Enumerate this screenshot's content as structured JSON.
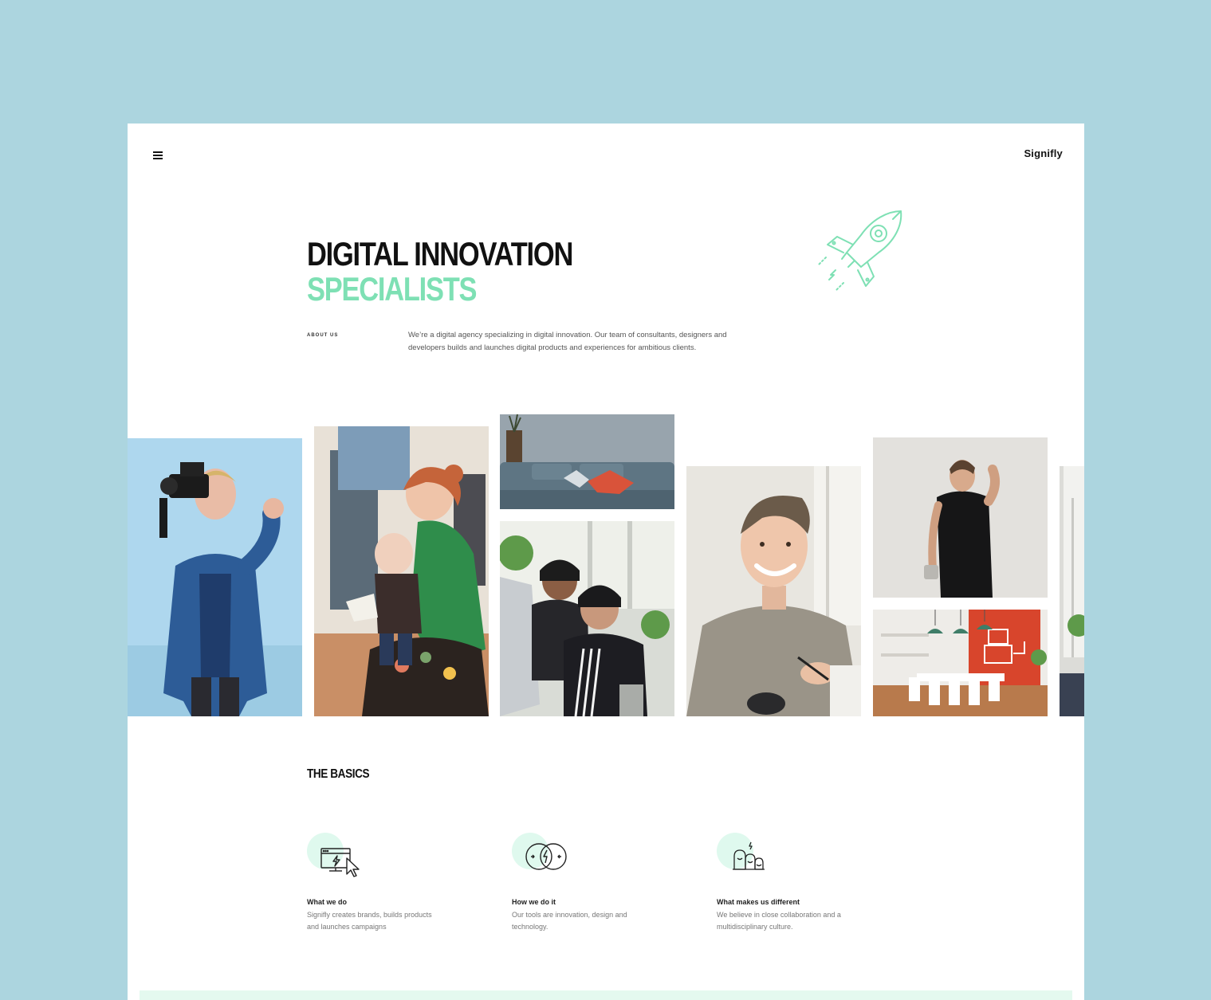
{
  "header": {
    "menu_icon": "hamburger-menu-icon",
    "logo": "Signifly"
  },
  "hero": {
    "title_line1": "DIGITAL INNOVATION",
    "title_line2": "SPECIALISTS",
    "illustration_icon": "rocket-icon",
    "about_label": "ABOUT US",
    "about_text": "We’re a digital agency specializing in digital innovation. Our team of consultants, designers and developers builds and launches digital products and experiences for ambitious clients."
  },
  "gallery": {
    "photos": [
      "videographer-photo",
      "woman-with-child-photo",
      "sofa-photo",
      "coworkers-photo",
      "smiling-man-photo",
      "man-with-mug-photo",
      "office-kitchen-photo",
      "window-photo"
    ]
  },
  "basics": {
    "title": "THE BASICS",
    "items": [
      {
        "icon": "computer-cursor-icon",
        "title": "What we do",
        "description": "Signifly creates brands, builds products and launches campaigns"
      },
      {
        "icon": "overlapping-circles-icon",
        "title": "How we do it",
        "description": "Our tools are innovation, design and technology."
      },
      {
        "icon": "team-faces-icon",
        "title": "What makes us different",
        "description": "We believe in close collaboration and a multidisciplinary culture."
      }
    ]
  },
  "colors": {
    "background": "#acd5df",
    "accent": "#7ee0b4",
    "accent_light": "#dff9ee",
    "text": "#111111"
  }
}
